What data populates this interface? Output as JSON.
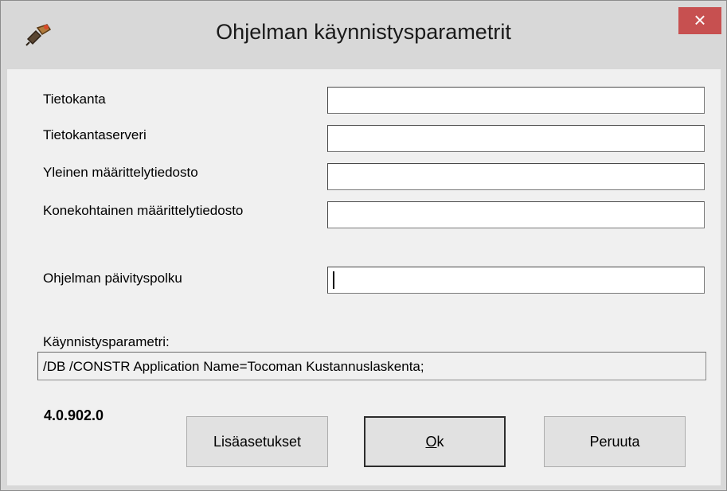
{
  "window": {
    "title": "Ohjelman käynnistysparametrit",
    "close_glyph": "×",
    "icon": "app-icon"
  },
  "form": {
    "fields": [
      {
        "label": "Tietokanta",
        "value": ""
      },
      {
        "label": "Tietokantaserveri",
        "value": ""
      },
      {
        "label": "Yleinen määrittelytiedosto",
        "value": ""
      },
      {
        "label": "Konekohtainen määrittelytiedosto",
        "value": ""
      }
    ],
    "update_path": {
      "label": "Ohjelman päivityspolku",
      "value": ""
    }
  },
  "startup_param": {
    "label": "Käynnistysparametri:",
    "value": "/DB  /CONSTR Application Name=Tocoman Kustannuslaskenta;"
  },
  "version": "4.0.902.0",
  "buttons": {
    "advanced": "Lisäasetukset",
    "ok_mnemonic": "O",
    "ok_rest": "k",
    "cancel": "Peruuta"
  },
  "colors": {
    "close_button": "#c75050",
    "titlebar": "#d8d8d8",
    "client": "#f0f0f0"
  }
}
